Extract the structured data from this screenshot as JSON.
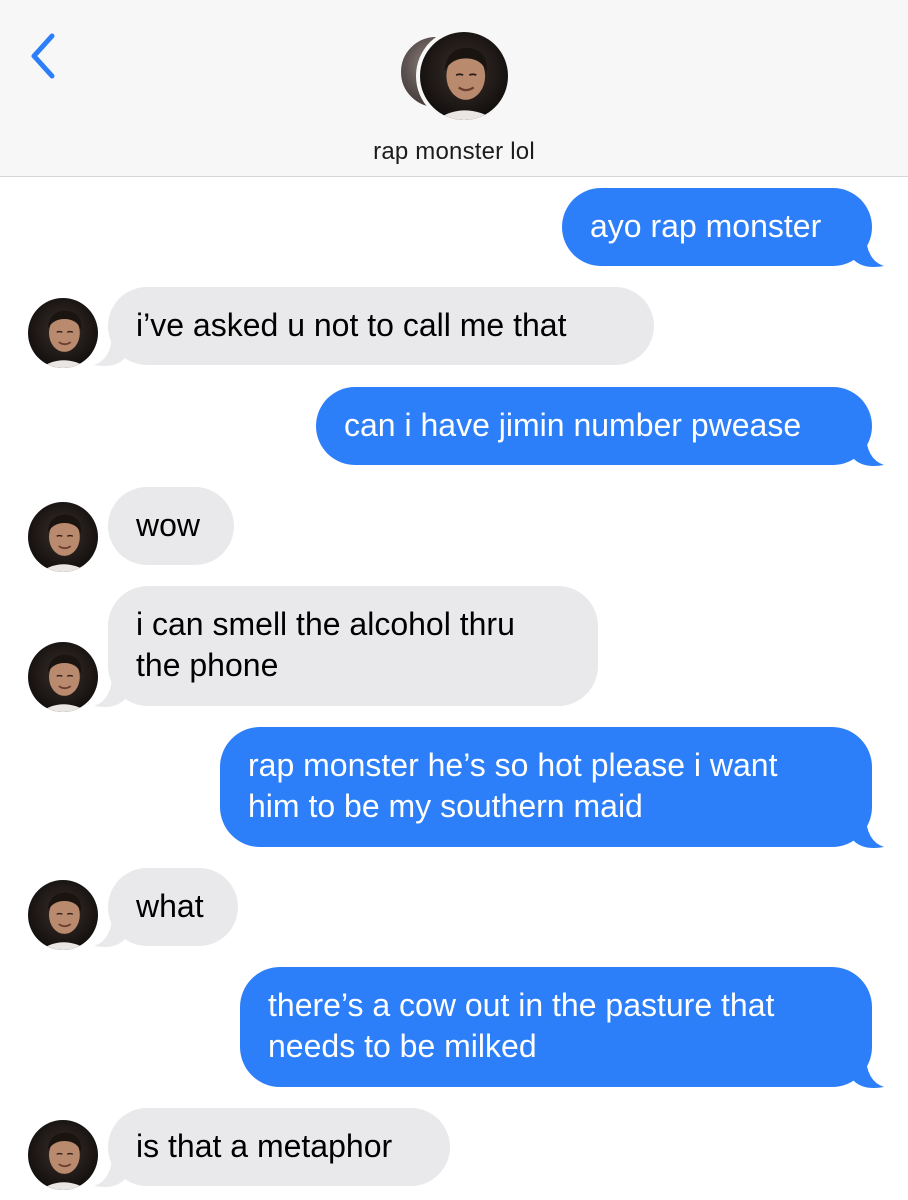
{
  "header": {
    "contact_name": "rap monster lol",
    "back_icon": "chevron-left-icon",
    "accent_color": "#2d7ff9"
  },
  "conversation": {
    "sent_color": "#2d7ff9",
    "received_color": "#e9e9eb",
    "messages": [
      {
        "from": "me",
        "text": "ayo rap monster"
      },
      {
        "from": "them",
        "text": "i’ve asked u not to call me that"
      },
      {
        "from": "me",
        "text": "can i have jimin number pwease"
      },
      {
        "from": "them",
        "text": "wow"
      },
      {
        "from": "them",
        "text": "i can smell the alcohol thru\nthe phone"
      },
      {
        "from": "me",
        "text": "rap monster he’s so hot please i want\nhim to be my southern maid"
      },
      {
        "from": "them",
        "text": "what"
      },
      {
        "from": "me",
        "text": "there’s a cow out in the pasture that\nneeds to be milked"
      },
      {
        "from": "them",
        "text": "is that a metaphor"
      }
    ]
  }
}
